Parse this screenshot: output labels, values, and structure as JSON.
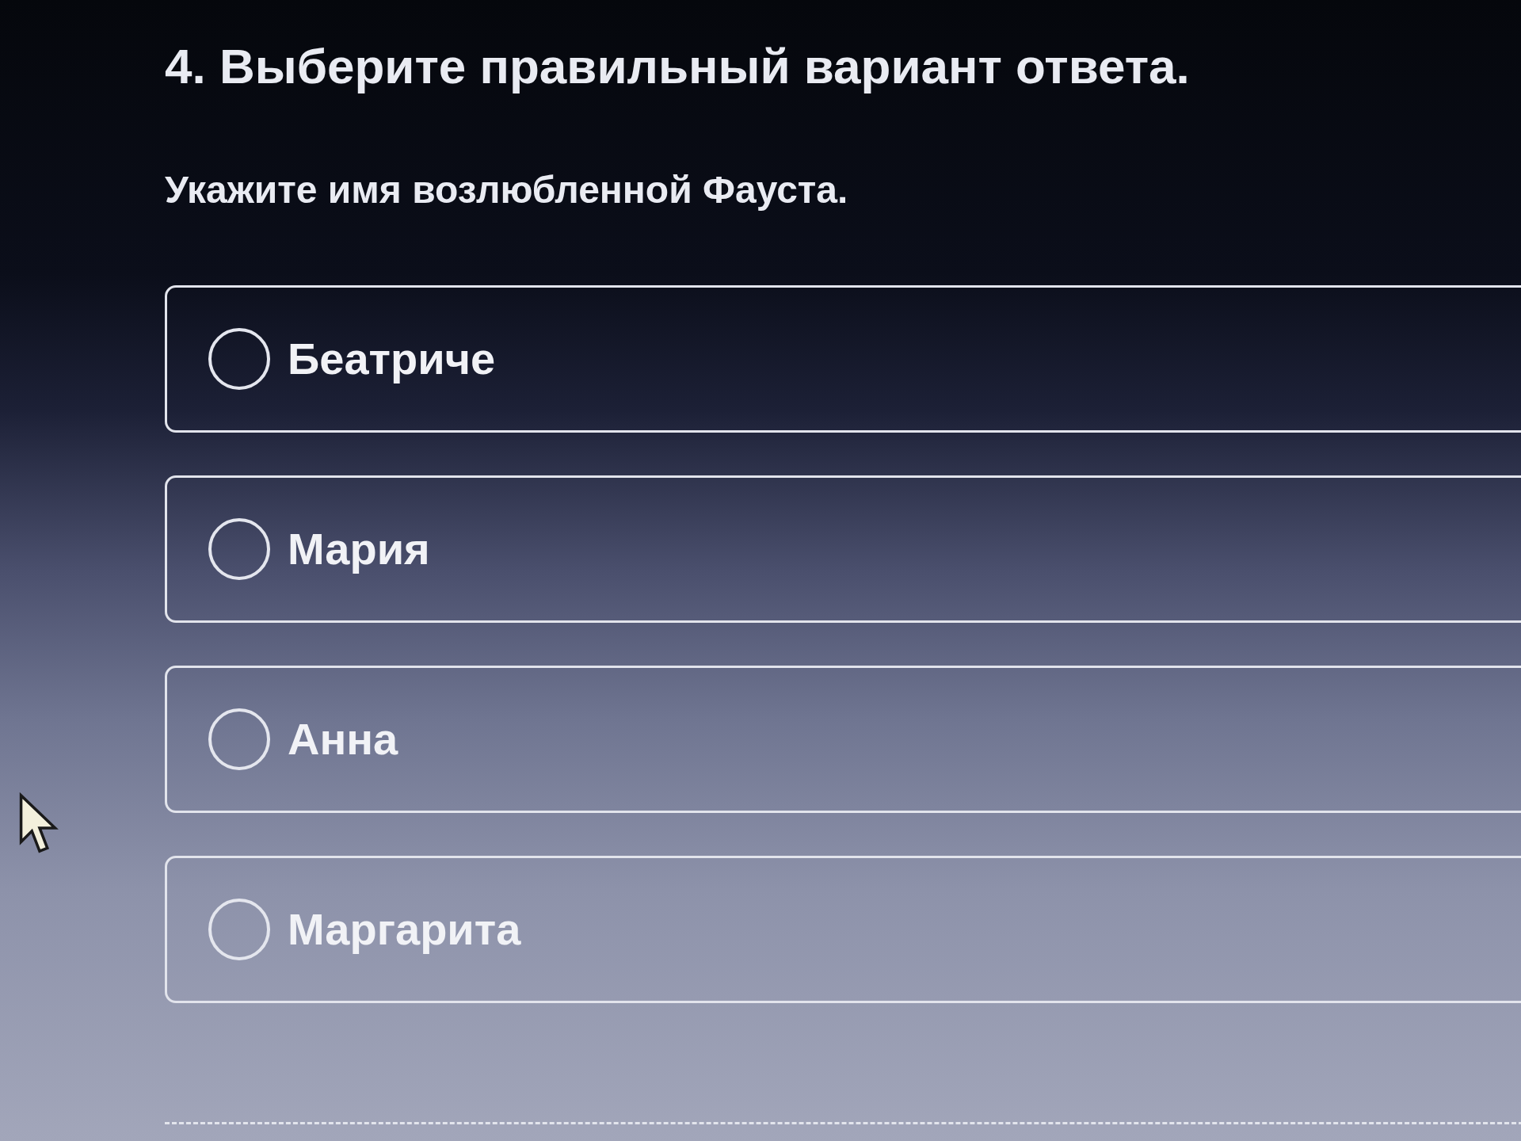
{
  "question": {
    "title": "4. Выберите правильный вариант ответа.",
    "prompt": "Укажите имя возлюбленной Фауста."
  },
  "options": [
    {
      "label": "Беатриче",
      "selected": false
    },
    {
      "label": "Мария",
      "selected": false
    },
    {
      "label": "Анна",
      "selected": false
    },
    {
      "label": "Маргарита",
      "selected": false
    }
  ]
}
